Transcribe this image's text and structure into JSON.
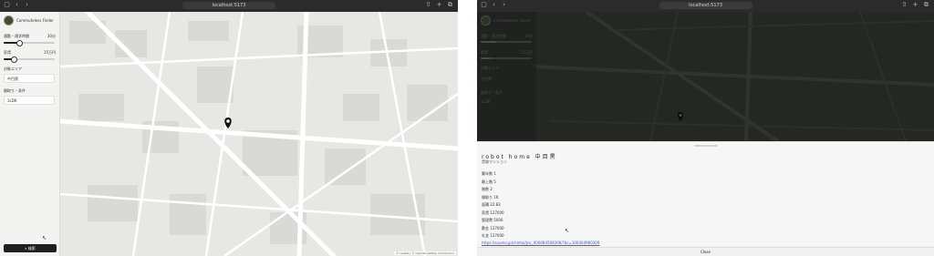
{
  "browser": {
    "url": "localhost:5173"
  },
  "left": {
    "brand": "Commuteless Finder",
    "controls": [
      {
        "label": "通勤・通学時間",
        "value": "30分"
      },
      {
        "label": "家賃",
        "value": "15万円"
      }
    ],
    "area_label": "対象エリア",
    "area_value": "中目黒",
    "layout_label": "間取り・条件",
    "layout_value": "1LDK",
    "search_label": "検索",
    "attribution": "© Leaflet | © OpenStreetMap contributors",
    "slider_levels": [
      0.3,
      0.2
    ]
  },
  "right": {
    "brand": "Commuteless Finder",
    "controls": [
      {
        "label": "通勤・通学時間",
        "value": "30分"
      },
      {
        "label": "家賃",
        "value": "15万円"
      }
    ],
    "area_label": "対象エリア",
    "area_value": "中目黒",
    "layout_label": "間取り・条件",
    "layout_value": "1LDK",
    "title": "robot home 中目黒",
    "subtitle": "賃貸マンション",
    "details": [
      "築年数 1",
      "最上階 5",
      "階数 2",
      "間取り 1K",
      "面積 22.83",
      "家賃 127000",
      "管理費 5000",
      "敷金 127000",
      "礼金 127000"
    ],
    "link": "https://suumo.jp/chintai/jnc_000084568306/?bc=100404980309",
    "close_label": "Close"
  },
  "colors": {
    "map_light": "#e6e6e3",
    "map_dark": "#232521",
    "link": "#2c5fd6"
  }
}
